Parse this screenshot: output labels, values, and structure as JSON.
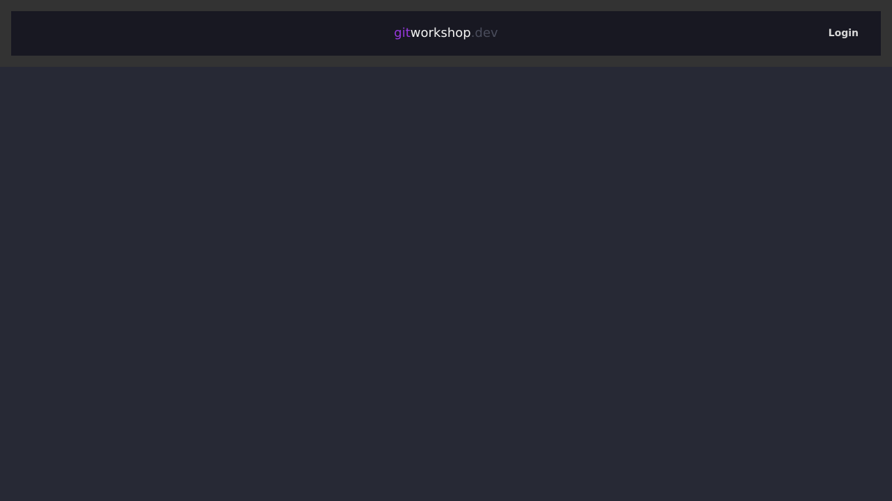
{
  "header": {
    "logo": {
      "part1": "git",
      "part2": "workshop",
      "part3": ".dev"
    },
    "login_label": "Login"
  },
  "colors": {
    "frame": "#333333",
    "header_bar": "#181822",
    "background": "#272935",
    "logo_accent": "#9a39e3",
    "logo_main": "#f3f3f3",
    "logo_muted": "#4a4d5c",
    "login_text": "#d8d8d8"
  }
}
